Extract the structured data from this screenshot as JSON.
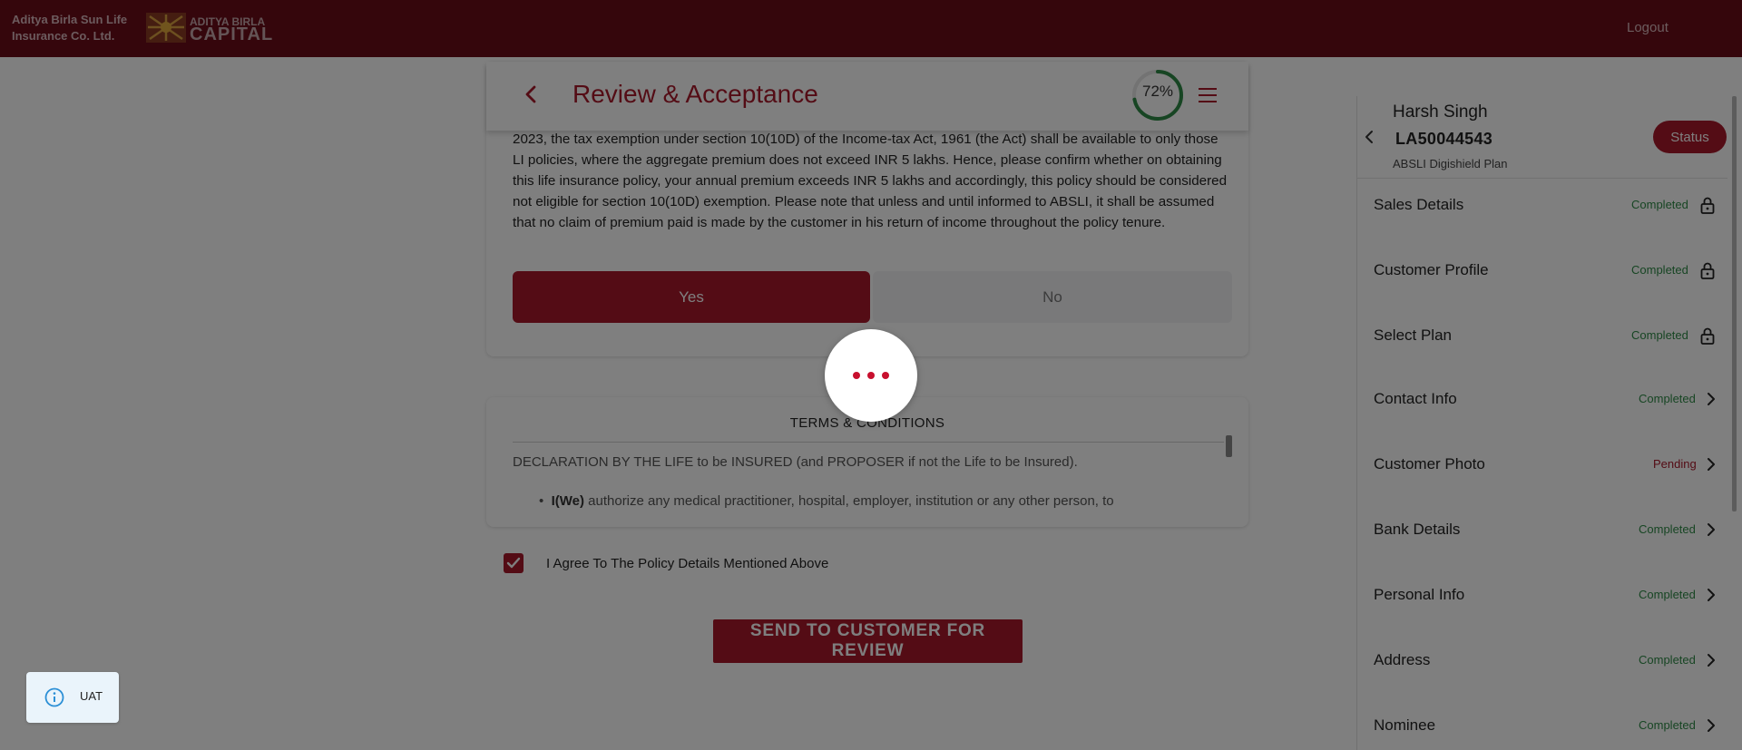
{
  "header": {
    "brand_line1": "Aditya Birla Sun Life",
    "brand_line2": "Insurance Co. Ltd.",
    "logo_line1": "ADITYA BIRLA",
    "logo_line2": "CAPITAL",
    "logout_label": "Logout",
    "bg_color": "#6b0c18"
  },
  "review": {
    "title": "Review & Acceptance",
    "back_icon": "chevron-left-icon",
    "menu_icon": "hamburger-menu-icon",
    "progress_label": "72%",
    "progress_value": 0.72,
    "tax_text": "2023, the tax exemption under section 10(10D) of the Income-tax Act, 1961 (the Act) shall be available to only those LI policies, where the aggregate premium does not exceed INR 5 lakhs. Hence, please confirm whether on obtaining this life insurance policy, your annual premium exceeds INR 5 lakhs and accordingly, this policy should be considered not eligible for section 10(10D) exemption. Please note that unless and until informed to ABSLI, it shall be assumed that no claim of premium paid is made by the customer in his return of income throughout the policy tenure.",
    "yes_label": "Yes",
    "no_label": "No",
    "selected_answer": "Yes"
  },
  "terms": {
    "title": "TERMS & CONDITIONS",
    "declaration": "DECLARATION BY THE LIFE to be INSURED (and PROPOSER if not the Life to be Insured).",
    "bullet_bold": "I(We)",
    "bullet_text": " authorize any medical practitioner, hospital, employer, institution or any other person, to"
  },
  "agree": {
    "checked": true,
    "label": "I Agree To The Policy Details Mentioned Above"
  },
  "send_button_label": "SEND TO CUSTOMER FOR REVIEW",
  "sidebar": {
    "name": "Harsh Singh",
    "application_id": "LA50044543",
    "plan": "ABSLI Digishield Plan",
    "status_label": "Status",
    "items": [
      {
        "label": "Sales Details",
        "status": "Completed",
        "icon": "lock-icon"
      },
      {
        "label": "Customer Profile",
        "status": "Completed",
        "icon": "lock-icon"
      },
      {
        "label": "Select Plan",
        "status": "Completed",
        "icon": "lock-icon"
      },
      {
        "label": "Contact Info",
        "status": "Completed",
        "icon": "chevron-right-icon"
      },
      {
        "label": "Customer Photo",
        "status": "Pending",
        "icon": "chevron-right-icon"
      },
      {
        "label": "Bank Details",
        "status": "Completed",
        "icon": "chevron-right-icon"
      },
      {
        "label": "Personal Info",
        "status": "Completed",
        "icon": "chevron-right-icon"
      },
      {
        "label": "Address",
        "status": "Completed",
        "icon": "chevron-right-icon"
      },
      {
        "label": "Nominee",
        "status": "Completed",
        "icon": "chevron-right-icon"
      }
    ]
  },
  "env_badge": {
    "label": "UAT",
    "icon": "info-icon"
  },
  "loader": {
    "visible": true
  },
  "colors": {
    "primary": "#a8182a",
    "completed": "#2e8b47",
    "pending": "#a8182a",
    "progress": "#2e8b47"
  }
}
